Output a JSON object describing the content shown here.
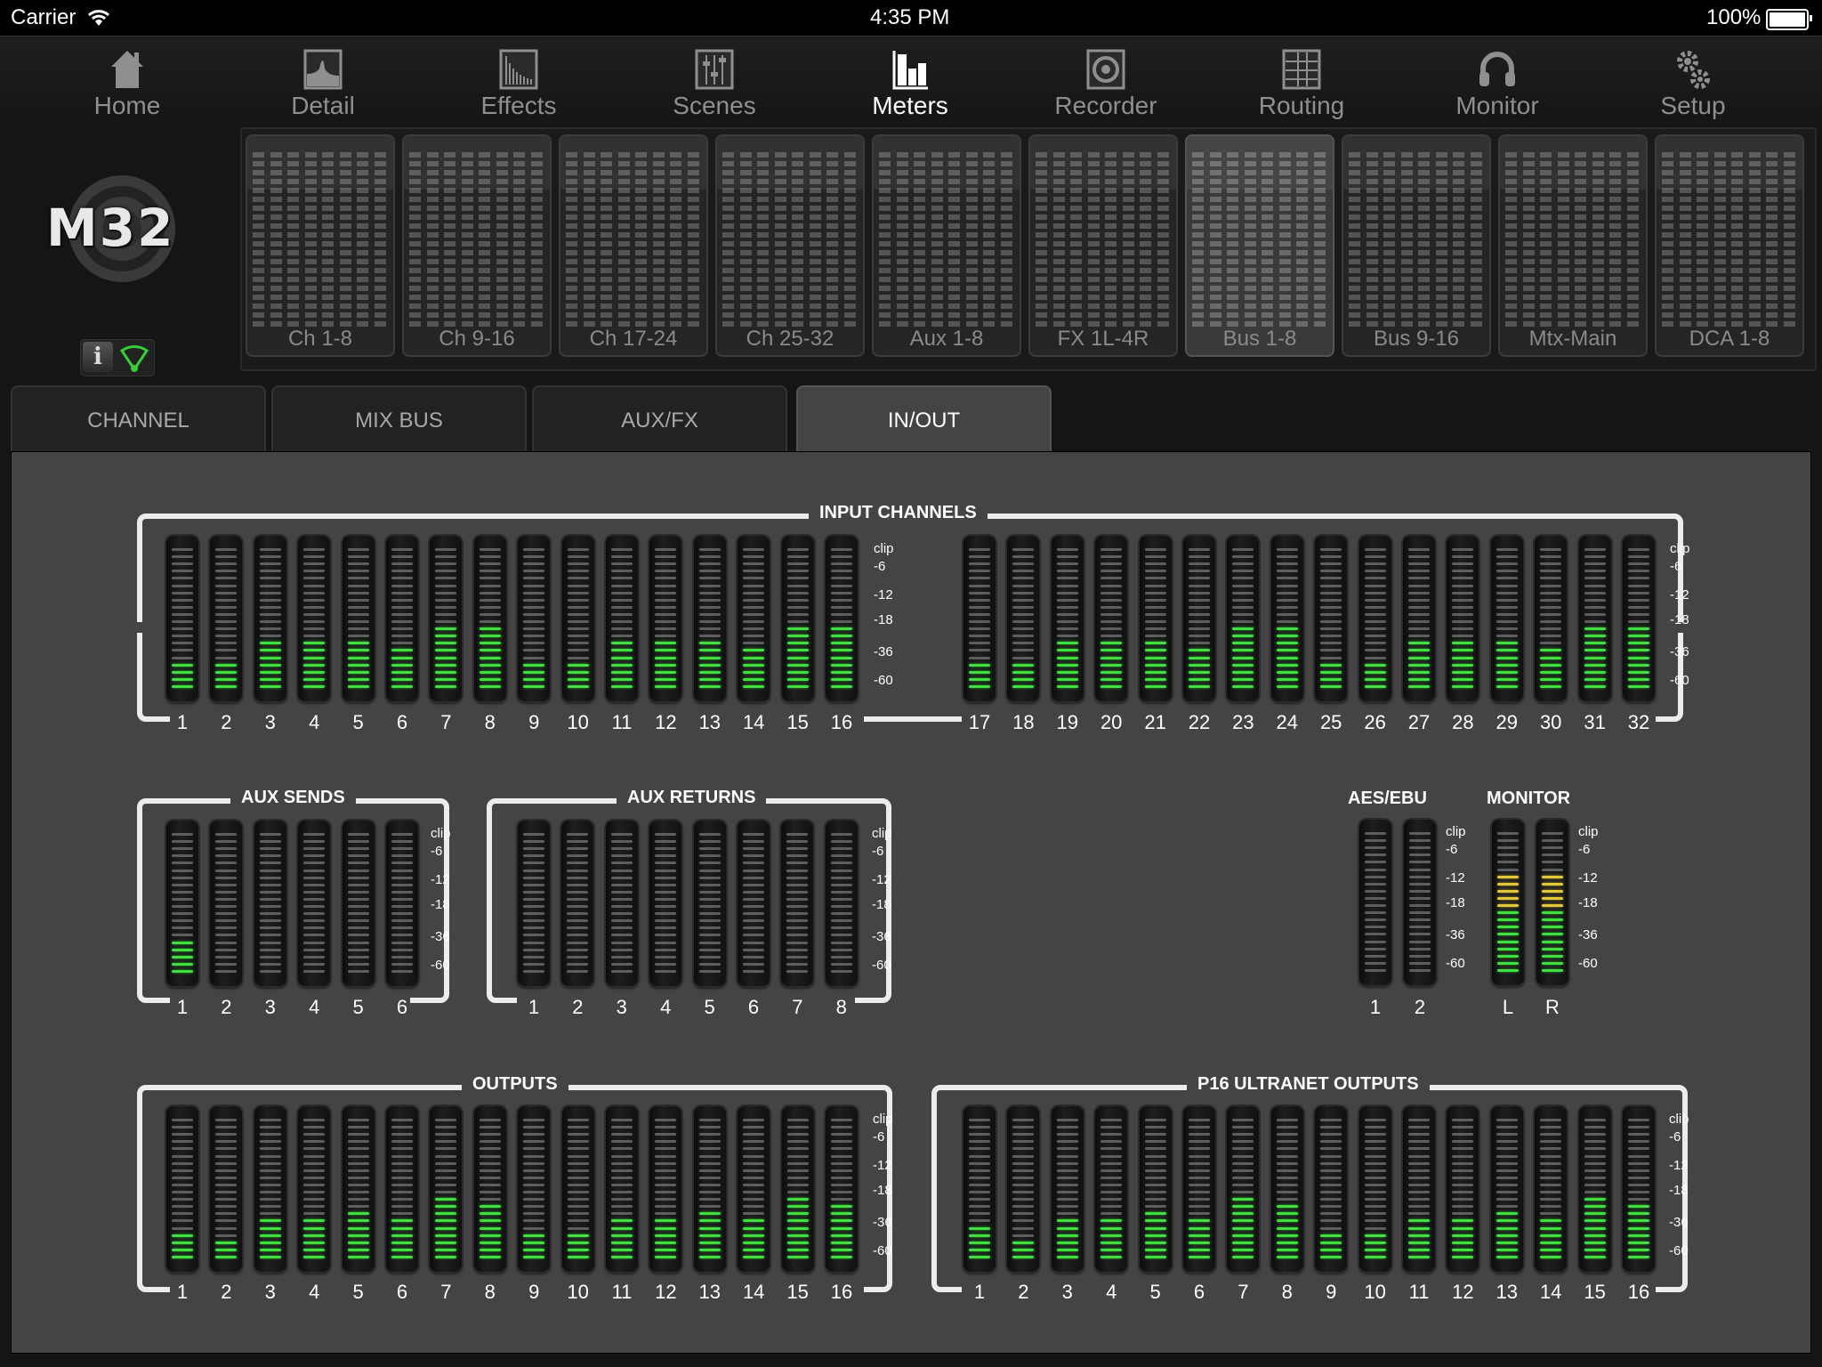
{
  "status_bar": {
    "carrier": "Carrier",
    "time": "4:35 PM",
    "battery": "100%"
  },
  "nav": [
    {
      "label": "Home",
      "icon": "home-icon",
      "active": false
    },
    {
      "label": "Detail",
      "icon": "detail-eq-icon",
      "active": false
    },
    {
      "label": "Effects",
      "icon": "effects-icon",
      "active": false
    },
    {
      "label": "Scenes",
      "icon": "scenes-faders-icon",
      "active": false
    },
    {
      "label": "Meters",
      "icon": "meters-bars-icon",
      "active": true
    },
    {
      "label": "Recorder",
      "icon": "recorder-icon",
      "active": false
    },
    {
      "label": "Routing",
      "icon": "routing-grid-icon",
      "active": false
    },
    {
      "label": "Monitor",
      "icon": "headphones-icon",
      "active": false
    },
    {
      "label": "Setup",
      "icon": "gears-icon",
      "active": false
    }
  ],
  "logo": {
    "text": "M32"
  },
  "banks": [
    {
      "label": "Ch 1-8",
      "active": false
    },
    {
      "label": "Ch 9-16",
      "active": false
    },
    {
      "label": "Ch 17-24",
      "active": false
    },
    {
      "label": "Ch 25-32",
      "active": false
    },
    {
      "label": "Aux 1-8",
      "active": false
    },
    {
      "label": "FX 1L-4R",
      "active": false
    },
    {
      "label": "Bus 1-8",
      "active": true
    },
    {
      "label": "Bus 9-16",
      "active": false
    },
    {
      "label": "Mtx-Main",
      "active": false
    },
    {
      "label": "DCA 1-8",
      "active": false
    }
  ],
  "tabs": [
    {
      "label": "CHANNEL",
      "active": false
    },
    {
      "label": "MIX BUS",
      "active": false
    },
    {
      "label": "AUX/FX",
      "active": false
    },
    {
      "label": "IN/OUT",
      "active": true
    }
  ],
  "meter_scale": [
    "clip",
    "-6",
    "-12",
    "-18",
    "-36",
    "-60"
  ],
  "segments_per_meter": 20,
  "colors": {
    "green": "#3fe03f",
    "yellow": "#e2c83b",
    "unlit": "#5e5e5e"
  },
  "sections": {
    "input_channels": {
      "title": "INPUT CHANNELS",
      "labels": [
        "1",
        "2",
        "3",
        "4",
        "5",
        "6",
        "7",
        "8",
        "9",
        "10",
        "11",
        "12",
        "13",
        "14",
        "15",
        "16",
        "17",
        "18",
        "19",
        "20",
        "21",
        "22",
        "23",
        "24",
        "25",
        "26",
        "27",
        "28",
        "29",
        "30",
        "31",
        "32"
      ],
      "lit_segments": [
        4,
        4,
        7,
        7,
        7,
        6,
        9,
        9,
        4,
        4,
        7,
        7,
        7,
        6,
        9,
        9,
        4,
        4,
        7,
        7,
        7,
        6,
        9,
        9,
        4,
        4,
        7,
        7,
        7,
        6,
        9,
        9
      ]
    },
    "aux_sends": {
      "title": "AUX SENDS",
      "labels": [
        "1",
        "2",
        "3",
        "4",
        "5",
        "6"
      ],
      "lit_segments": [
        5,
        0,
        0,
        0,
        0,
        0
      ]
    },
    "aux_returns": {
      "title": "AUX RETURNS",
      "labels": [
        "1",
        "2",
        "3",
        "4",
        "5",
        "6",
        "7",
        "8"
      ],
      "lit_segments": [
        0,
        0,
        0,
        0,
        0,
        0,
        0,
        0
      ]
    },
    "aes_ebu": {
      "title": "AES/EBU",
      "labels": [
        "1",
        "2"
      ],
      "lit_segments": [
        0,
        0
      ]
    },
    "monitor": {
      "title": "MONITOR",
      "labels": [
        "L",
        "R"
      ],
      "lit_segments": [
        14,
        14
      ],
      "yellow_from_segment": 10
    },
    "outputs": {
      "title": "OUTPUTS",
      "labels": [
        "1",
        "2",
        "3",
        "4",
        "5",
        "6",
        "7",
        "8",
        "9",
        "10",
        "11",
        "12",
        "13",
        "14",
        "15",
        "16"
      ],
      "lit_segments": [
        4,
        3,
        6,
        6,
        7,
        6,
        9,
        8,
        4,
        4,
        6,
        6,
        7,
        6,
        9,
        8
      ]
    },
    "p16_outputs": {
      "title": "P16 ULTRANET OUTPUTS",
      "labels": [
        "1",
        "2",
        "3",
        "4",
        "5",
        "6",
        "7",
        "8",
        "9",
        "10",
        "11",
        "12",
        "13",
        "14",
        "15",
        "16"
      ],
      "lit_segments": [
        5,
        3,
        6,
        6,
        7,
        6,
        9,
        8,
        4,
        4,
        6,
        6,
        7,
        6,
        9,
        8
      ]
    }
  }
}
